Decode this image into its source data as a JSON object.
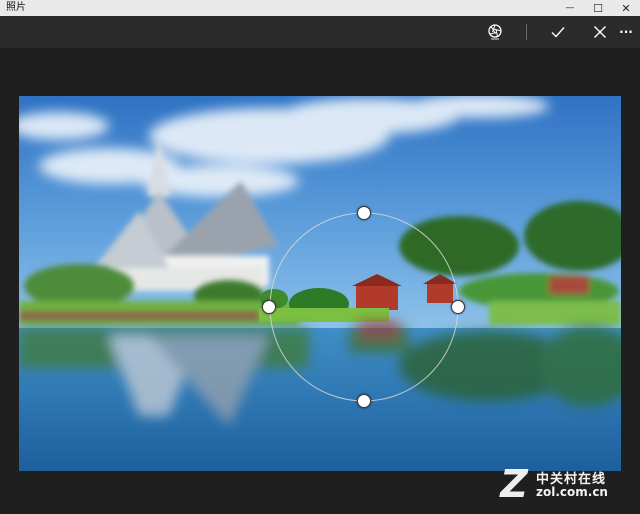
{
  "window": {
    "title": "照片",
    "minimize_glyph": "—",
    "maximize_glyph": "☐",
    "close_glyph": "✕"
  },
  "toolbar": {
    "items": [
      {
        "name": "aperture-icon",
        "label": "aperture"
      },
      {
        "name": "check-icon",
        "label": "apply"
      },
      {
        "name": "cancel-icon",
        "label": "cancel"
      },
      {
        "name": "more-icon",
        "label": "more"
      }
    ],
    "more_glyph": "···"
  },
  "watermark": {
    "logo_letter": "Z",
    "chinese_text": "中关村在线",
    "url_text": "zol.com.cn"
  },
  "colors": {
    "titlebar_bg": "#e9e9e9",
    "toolbar_bg": "#2b2b2b",
    "canvas_bg": "#1f1f1f",
    "handle": "#ffffff"
  }
}
